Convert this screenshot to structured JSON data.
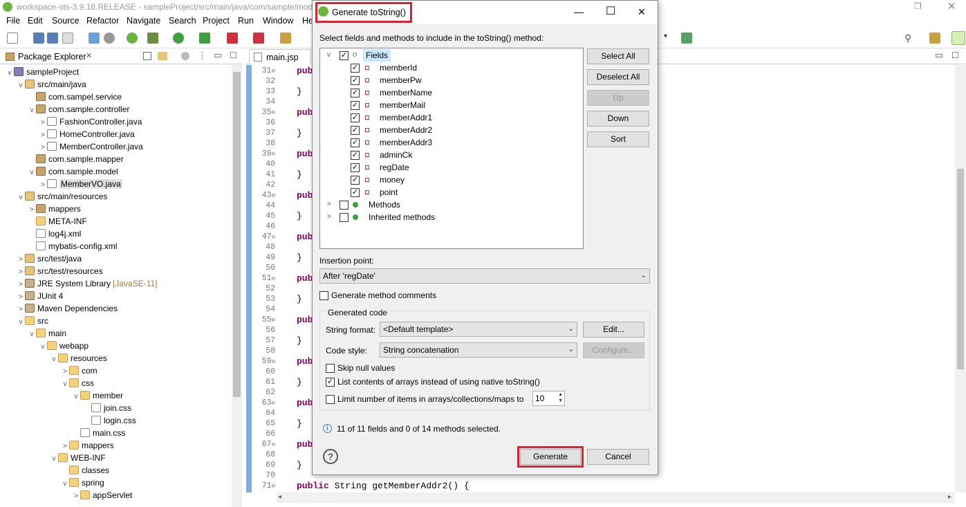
{
  "window": {
    "title": "workspace-sts-3.9.18.RELEASE - sampleProject/src/main/java/com/sample/mod"
  },
  "menu": [
    "File",
    "Edit",
    "Source",
    "Refactor",
    "Navigate",
    "Search",
    "Project",
    "Run",
    "Window",
    "He"
  ],
  "package_explorer": {
    "tab_label": "Package Explorer",
    "tree": [
      {
        "label": "sampleProject",
        "depth": 0,
        "arrow": "v",
        "icon": "proj"
      },
      {
        "label": "src/main/java",
        "depth": 1,
        "arrow": "v",
        "icon": "src"
      },
      {
        "label": "com.sampel.service",
        "depth": 2,
        "arrow": "",
        "icon": "pkg"
      },
      {
        "label": "com.sample.controller",
        "depth": 2,
        "arrow": "v",
        "icon": "pkg"
      },
      {
        "label": "FashionController.java",
        "depth": 3,
        "arrow": ">",
        "icon": "java"
      },
      {
        "label": "HomeController.java",
        "depth": 3,
        "arrow": ">",
        "icon": "java"
      },
      {
        "label": "MemberController.java",
        "depth": 3,
        "arrow": ">",
        "icon": "java"
      },
      {
        "label": "com.sample.mapper",
        "depth": 2,
        "arrow": "",
        "icon": "pkg"
      },
      {
        "label": "com.sample.model",
        "depth": 2,
        "arrow": "v",
        "icon": "pkg"
      },
      {
        "label": "MemberVO.java",
        "depth": 3,
        "arrow": ">",
        "icon": "java",
        "selected": true
      },
      {
        "label": "src/main/resources",
        "depth": 1,
        "arrow": "v",
        "icon": "src"
      },
      {
        "label": "mappers",
        "depth": 2,
        "arrow": ">",
        "icon": "pkg"
      },
      {
        "label": "META-INF",
        "depth": 2,
        "arrow": "",
        "icon": "folder"
      },
      {
        "label": "log4j.xml",
        "depth": 2,
        "arrow": "",
        "icon": "file"
      },
      {
        "label": "mybatis-config.xml",
        "depth": 2,
        "arrow": "",
        "icon": "file"
      },
      {
        "label": "src/test/java",
        "depth": 1,
        "arrow": ">",
        "icon": "src"
      },
      {
        "label": "src/test/resources",
        "depth": 1,
        "arrow": ">",
        "icon": "src"
      },
      {
        "label": "JRE System Library",
        "suffix": "[JavaSE-11]",
        "depth": 1,
        "arrow": ">",
        "icon": "lib"
      },
      {
        "label": "JUnit 4",
        "depth": 1,
        "arrow": ">",
        "icon": "lib"
      },
      {
        "label": "Maven Dependencies",
        "depth": 1,
        "arrow": ">",
        "icon": "lib"
      },
      {
        "label": "src",
        "depth": 1,
        "arrow": "v",
        "icon": "folder"
      },
      {
        "label": "main",
        "depth": 2,
        "arrow": "v",
        "icon": "folder"
      },
      {
        "label": "webapp",
        "depth": 3,
        "arrow": "v",
        "icon": "folder"
      },
      {
        "label": "resources",
        "depth": 4,
        "arrow": "v",
        "icon": "folder"
      },
      {
        "label": "com",
        "depth": 5,
        "arrow": ">",
        "icon": "folder"
      },
      {
        "label": "css",
        "depth": 5,
        "arrow": "v",
        "icon": "folder"
      },
      {
        "label": "member",
        "depth": 6,
        "arrow": "v",
        "icon": "folder"
      },
      {
        "label": "join.css",
        "depth": 7,
        "arrow": "",
        "icon": "file"
      },
      {
        "label": "login.css",
        "depth": 7,
        "arrow": "",
        "icon": "file"
      },
      {
        "label": "main.css",
        "depth": 6,
        "arrow": "",
        "icon": "file"
      },
      {
        "label": "mappers",
        "depth": 5,
        "arrow": ">",
        "icon": "folder"
      },
      {
        "label": "WEB-INF",
        "depth": 4,
        "arrow": "v",
        "icon": "folder"
      },
      {
        "label": "classes",
        "depth": 5,
        "arrow": "",
        "icon": "folder"
      },
      {
        "label": "spring",
        "depth": 5,
        "arrow": "v",
        "icon": "folder"
      },
      {
        "label": "appServlet",
        "depth": 6,
        "arrow": ">",
        "icon": "folder"
      }
    ]
  },
  "editor": {
    "tab_label": "main.jsp",
    "lines": [
      {
        "n": "31",
        "fold": true,
        "code": "publ"
      },
      {
        "n": "32",
        "code": ""
      },
      {
        "n": "33",
        "code": "}"
      },
      {
        "n": "34",
        "code": ""
      },
      {
        "n": "35",
        "fold": true,
        "code": "publ"
      },
      {
        "n": "36",
        "code": ""
      },
      {
        "n": "37",
        "code": "}"
      },
      {
        "n": "38",
        "code": ""
      },
      {
        "n": "39",
        "fold": true,
        "code": "publ"
      },
      {
        "n": "40",
        "code": ""
      },
      {
        "n": "41",
        "code": "}"
      },
      {
        "n": "42",
        "code": ""
      },
      {
        "n": "43",
        "fold": true,
        "code": "publ"
      },
      {
        "n": "44",
        "code": ""
      },
      {
        "n": "45",
        "code": "}"
      },
      {
        "n": "46",
        "code": ""
      },
      {
        "n": "47",
        "fold": true,
        "code": "publ"
      },
      {
        "n": "48",
        "code": ""
      },
      {
        "n": "49",
        "code": "}"
      },
      {
        "n": "50",
        "code": ""
      },
      {
        "n": "51",
        "fold": true,
        "code": "publ"
      },
      {
        "n": "52",
        "code": ""
      },
      {
        "n": "53",
        "code": "}"
      },
      {
        "n": "54",
        "code": ""
      },
      {
        "n": "55",
        "fold": true,
        "code": "publ"
      },
      {
        "n": "56",
        "code": ""
      },
      {
        "n": "57",
        "code": "}"
      },
      {
        "n": "58",
        "code": ""
      },
      {
        "n": "59",
        "fold": true,
        "code": "publ"
      },
      {
        "n": "60",
        "code": ""
      },
      {
        "n": "61",
        "code": "}"
      },
      {
        "n": "62",
        "code": ""
      },
      {
        "n": "63",
        "fold": true,
        "code": "publ"
      },
      {
        "n": "64",
        "code": ""
      },
      {
        "n": "65",
        "code": "}"
      },
      {
        "n": "66",
        "code": ""
      },
      {
        "n": "67",
        "fold": true,
        "code": "publ"
      },
      {
        "n": "68",
        "code": ""
      },
      {
        "n": "69",
        "code": "}"
      },
      {
        "n": "70",
        "code": ""
      },
      {
        "n": "71",
        "fold": true,
        "code": "public String getMemberAddr2() {"
      }
    ]
  },
  "dialog": {
    "title": "Generate toString()",
    "select_label": "Select fields and methods to include in the toString() method:",
    "fields_group": "Fields",
    "fields": [
      "memberId",
      "memberPw",
      "memberName",
      "memberMail",
      "memberAddr1",
      "memberAddr2",
      "memberAddr3",
      "adminCk",
      "regDate",
      "money",
      "point"
    ],
    "methods_group": "Methods",
    "inherited_group": "Inherited methods",
    "buttons": {
      "select_all": "Select All",
      "deselect_all": "Deselect All",
      "up": "Up",
      "down": "Down",
      "sort": "Sort"
    },
    "insertion_label": "Insertion point:",
    "insertion_value": "After 'regDate'",
    "gen_comments_label": "Generate method comments",
    "generated_code_label": "Generated code",
    "string_format_label": "String format:",
    "string_format_value": "<Default template>",
    "edit_button": "Edit...",
    "code_style_label": "Code style:",
    "code_style_value": "String concatenation",
    "configure_button": "Configure...",
    "skip_null_label": "Skip null values",
    "list_arrays_label": "List contents of arrays instead of using native toString()",
    "limit_label": "Limit number of items in arrays/collections/maps to",
    "limit_value": "10",
    "status": "11 of 11 fields and 0 of 14 methods selected.",
    "generate_button": "Generate",
    "cancel_button": "Cancel",
    "help_glyph": "?",
    "info_glyph": "i",
    "check_glyph": "✓",
    "min_glyph": "—",
    "max_glyph": "☐",
    "close_glyph": "✕"
  }
}
